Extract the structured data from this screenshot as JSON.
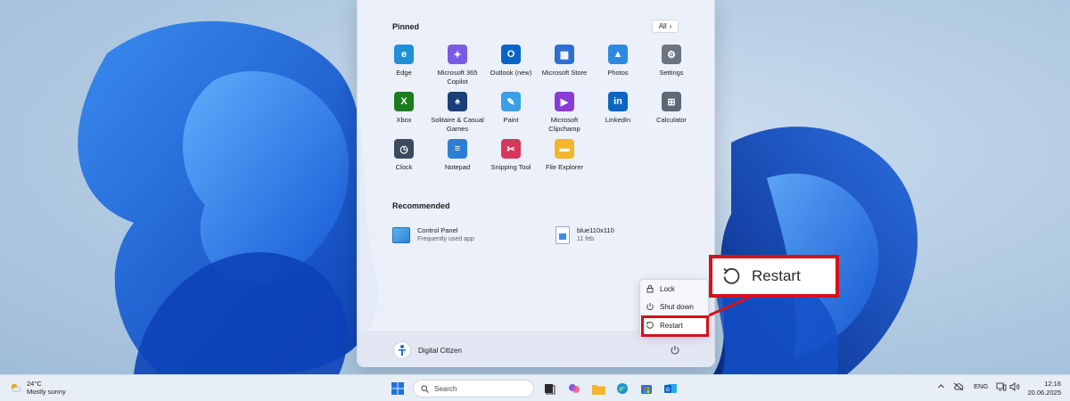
{
  "start_menu": {
    "pinned_title": "Pinned",
    "all_button_label": "All",
    "pinned_apps": [
      {
        "label": "Edge",
        "icon": "edge-icon",
        "color": "#1f8fd6"
      },
      {
        "label": "Microsoft 365 Copilot",
        "icon": "copilot-icon",
        "color": "#7b5be6"
      },
      {
        "label": "Outlook (new)",
        "icon": "outlook-icon",
        "color": "#0a64c8"
      },
      {
        "label": "Microsoft Store",
        "icon": "store-icon",
        "color": "#2f6fd1"
      },
      {
        "label": "Photos",
        "icon": "photos-icon",
        "color": "#2d8ae0"
      },
      {
        "label": "Settings",
        "icon": "gear-icon",
        "color": "#6b7480"
      },
      {
        "label": "Xbox",
        "icon": "xbox-icon",
        "color": "#1b7d1b"
      },
      {
        "label": "Solitaire & Casual Games",
        "icon": "solitaire-icon",
        "color": "#1a3f7a"
      },
      {
        "label": "Paint",
        "icon": "paint-icon",
        "color": "#3aa0e6"
      },
      {
        "label": "Microsoft Clipchamp",
        "icon": "clipchamp-icon",
        "color": "#8a3ad6"
      },
      {
        "label": "LinkedIn",
        "icon": "linkedin-icon",
        "color": "#0a66c2"
      },
      {
        "label": "Calculator",
        "icon": "calculator-icon",
        "color": "#5d6874"
      },
      {
        "label": "Clock",
        "icon": "clock-icon",
        "color": "#3b4a5c"
      },
      {
        "label": "Notepad",
        "icon": "notepad-icon",
        "color": "#2a7fd4"
      },
      {
        "label": "Snipping Tool",
        "icon": "snipping-tool-icon",
        "color": "#d9365b"
      },
      {
        "label": "File Explorer",
        "icon": "folder-icon",
        "color": "#f2b52b"
      }
    ],
    "recommended_title": "Recommended",
    "recommended": [
      {
        "title": "Control Panel",
        "subtitle": "Frequently used app",
        "icon": "control-panel-icon"
      },
      {
        "title": "blue110x110",
        "subtitle": "11 feb.",
        "icon": "image-file-icon"
      }
    ],
    "user_name": "Digital Citizen"
  },
  "power_menu": {
    "items": [
      {
        "label": "Lock",
        "icon": "lock-icon"
      },
      {
        "label": "Shut down",
        "icon": "power-icon"
      },
      {
        "label": "Restart",
        "icon": "restart-icon"
      }
    ]
  },
  "callout": {
    "label": "Restart"
  },
  "taskbar": {
    "weather_temp": "24°C",
    "weather_condition": "Mostly sunny",
    "search_placeholder": "Search",
    "language": "ENG",
    "time": "12:16",
    "date": "20.06.2025"
  },
  "colors": {
    "highlight": "#d41219",
    "accent": "#1f6fd6"
  }
}
